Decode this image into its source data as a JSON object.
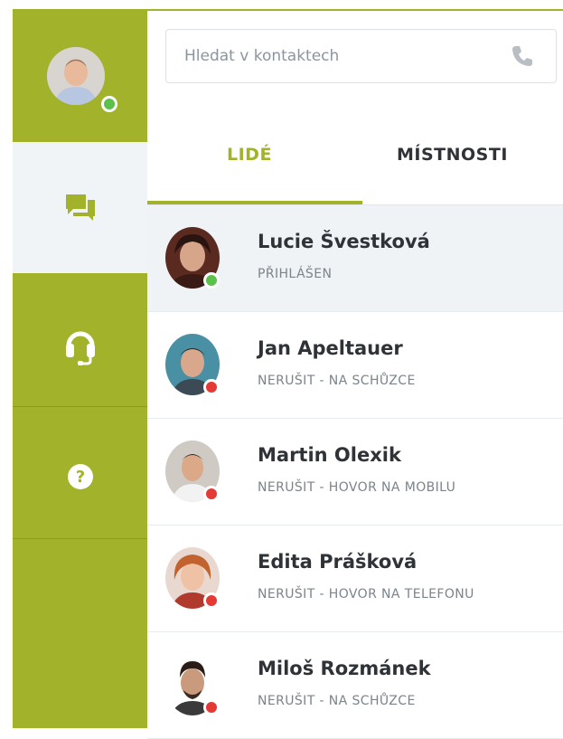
{
  "search": {
    "placeholder": "Hledat v kontaktech"
  },
  "tabs": [
    {
      "label": "LIDÉ",
      "active": true
    },
    {
      "label": "MÍSTNOSTI",
      "active": false
    }
  ],
  "sidebar": {
    "me_status_color": "#5cc14a",
    "items": [
      {
        "icon": "chat-icon",
        "active": true
      },
      {
        "icon": "headset-icon",
        "active": false
      },
      {
        "icon": "help-icon",
        "active": false
      }
    ]
  },
  "colors": {
    "accent": "#a2b22b",
    "online": "#5cc14a",
    "busy": "#e53935"
  },
  "contacts": [
    {
      "name": "Lucie Švestková",
      "status": "PŘIHLÁŠEN",
      "status_color": "#5cc14a",
      "active": true
    },
    {
      "name": "Jan Apeltauer",
      "status": "NERUŠIT - NA SCHŮZCE",
      "status_color": "#e53935",
      "active": false
    },
    {
      "name": "Martin Olexik",
      "status": "NERUŠIT - HOVOR NA MOBILU",
      "status_color": "#e53935",
      "active": false
    },
    {
      "name": "Edita Prášková",
      "status": "NERUŠIT - HOVOR NA TELEFONU",
      "status_color": "#e53935",
      "active": false
    },
    {
      "name": "Miloš Rozmánek",
      "status": "NERUŠIT - NA SCHŮZCE",
      "status_color": "#e53935",
      "active": false
    }
  ]
}
